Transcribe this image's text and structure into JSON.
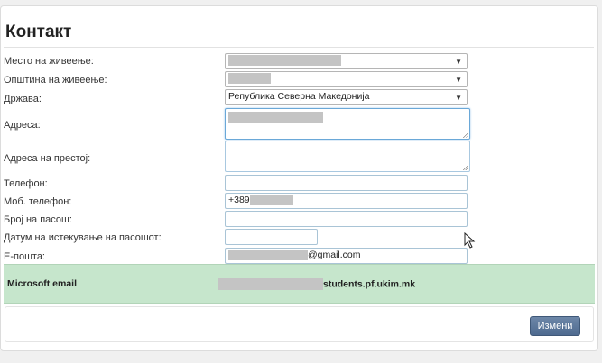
{
  "title": "Контакт",
  "labels": {
    "residence": "Место на живеење:",
    "municipality": "Општина на живеење:",
    "country": "Држава:",
    "address": "Адреса:",
    "stay_address": "Адреса на престој:",
    "phone": "Телефон:",
    "mobile": "Моб. телефон:",
    "passport": "Број на пасош:",
    "passport_expiry": "Датум на истекување на пасошот:",
    "email": "Е-пошта:"
  },
  "values": {
    "country": "Република Северна Македонија",
    "mobile_prefix": "+389",
    "email_suffix": "@gmail.com",
    "phone": "",
    "passport": "",
    "passport_expiry": "",
    "stay_address": ""
  },
  "microsoft": {
    "label": "Microsoft email",
    "domain": "students.pf.ukim.mk"
  },
  "buttons": {
    "save": "Измени"
  },
  "colors": {
    "microsoft_row_bg": "#c6e6cc",
    "button_bg": "#5a7599"
  }
}
